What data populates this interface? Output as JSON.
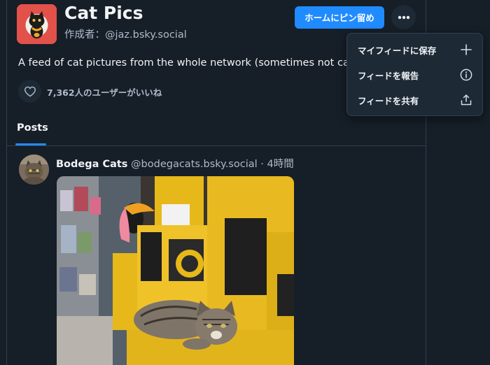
{
  "feed": {
    "title": "Cat Pics",
    "creator": "作成者：@jaz.bsky.social",
    "description": "A feed of cat pictures from the whole network (sometimes not cats)",
    "likes": "7,362人のユーザーがいいね",
    "pin_label": "ホームにピン留め",
    "avatar_icon": "cat-icon",
    "avatar_color": "#e2524a"
  },
  "tabs": [
    {
      "label": "Posts",
      "active": true
    }
  ],
  "menu": {
    "items": [
      {
        "label": "マイフィードに保存",
        "icon": "plus-icon"
      },
      {
        "label": "フィードを報告",
        "icon": "info-icon"
      },
      {
        "label": "フィードを共有",
        "icon": "share-icon"
      }
    ]
  },
  "post": {
    "author": "Bodega Cats",
    "handle": "@bodegacats.bsky.social",
    "separator": "·",
    "time": "4時間"
  },
  "colors": {
    "accent": "#208bfe",
    "background": "#161e27",
    "surface": "#1e2936",
    "border": "#2e4052",
    "secondary_text": "#aebbc9"
  }
}
